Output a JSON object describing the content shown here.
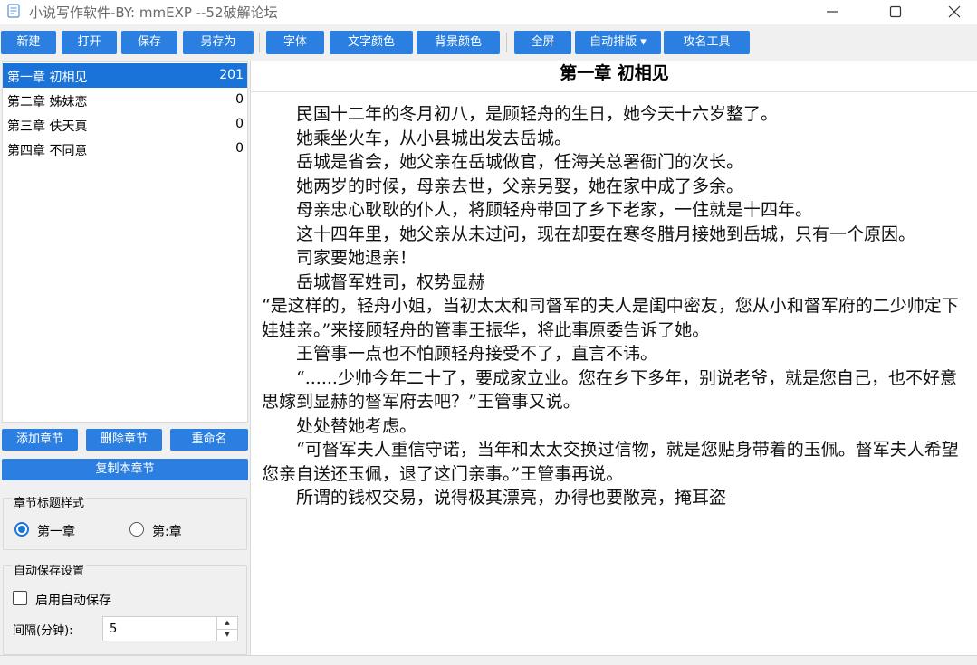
{
  "window": {
    "title": "小说写作软件-BY: mmEXP --52破解论坛"
  },
  "toolbar": {
    "buttons": [
      {
        "label": "新建"
      },
      {
        "label": "打开"
      },
      {
        "label": "保存"
      },
      {
        "label": "另存为"
      },
      {
        "label": "字体"
      },
      {
        "label": "文字颜色"
      },
      {
        "label": "背景颜色"
      },
      {
        "label": "全屏"
      },
      {
        "label": "自动排版 ▾"
      },
      {
        "label": "攻名工具"
      }
    ]
  },
  "colors": {
    "accent": "#2a7fe0",
    "selection": "#1a73d9"
  },
  "chapters": [
    {
      "title": "第一章 初相见",
      "count": "201",
      "selected": true
    },
    {
      "title": "第二章 姊妹恋",
      "count": "0",
      "selected": false
    },
    {
      "title": "第三章 伕天真",
      "count": "0",
      "selected": false
    },
    {
      "title": "第四章 不同意",
      "count": "0",
      "selected": false
    }
  ],
  "chapter_actions": {
    "add": "添加章节",
    "delete": "删除章节",
    "rename": "重命名",
    "copy": "复制本章节"
  },
  "title_style": {
    "group_title": "章节标题样式",
    "options": [
      {
        "label": "第一章",
        "selected": true
      },
      {
        "label": "第:章",
        "selected": false
      }
    ]
  },
  "autosave": {
    "group_title": "自动保存设置",
    "enable_label": "启用自动保存",
    "enabled": false,
    "interval_label": "间隔(分钟):",
    "interval_value": "5"
  },
  "editor": {
    "chapter_title": "第一章  初相见",
    "paragraphs": [
      {
        "text": "民国十二年的冬月初八，是顾轻舟的生日，她今天十六岁整了。",
        "indent": true
      },
      {
        "text": "她乘坐火车，从小县城出发去岳城。",
        "indent": true
      },
      {
        "text": "岳城是省会，她父亲在岳城做官，任海关总署衙门的次长。",
        "indent": true
      },
      {
        "text": "她两岁的时候，母亲去世，父亲另娶，她在家中成了多余。",
        "indent": true
      },
      {
        "text": "母亲忠心耿耿的仆人，将顾轻舟带回了乡下老家，一住就是十四年。",
        "indent": true
      },
      {
        "text": "这十四年里，她父亲从未过问，现在却要在寒冬腊月接她到岳城，只有一个原因。",
        "indent": true
      },
      {
        "text": "司家要她退亲！",
        "indent": true
      },
      {
        "text": "岳城督军姓司，权势显赫",
        "indent": true
      },
      {
        "text": "“是这样的，轻舟小姐，当初太太和司督军的夫人是闺中密友，您从小和督军府的二少帅定下娃娃亲。”来接顾轻舟的管事王振华，将此事原委告诉了她。",
        "indent": false
      },
      {
        "text": "王管事一点也不怕顾轻舟接受不了，直言不讳。",
        "indent": true
      },
      {
        "text": "“......少帅今年二十了，要成家立业。您在乡下多年，别说老爷，就是您自己，也不好意思嫁到显赫的督军府去吧？”王管事又说。",
        "indent": true
      },
      {
        "text": "处处替她考虑。",
        "indent": true
      },
      {
        "text": "“可督军夫人重信守诺，当年和太太交换过信物，就是您贴身带着的玉佩。督军夫人希望您亲自送还玉佩，退了这门亲事。”王管事再说。",
        "indent": true
      },
      {
        "text": "所谓的钱权交易，说得极其漂亮，办得也要敞亮，掩耳盗",
        "indent": true
      }
    ]
  }
}
